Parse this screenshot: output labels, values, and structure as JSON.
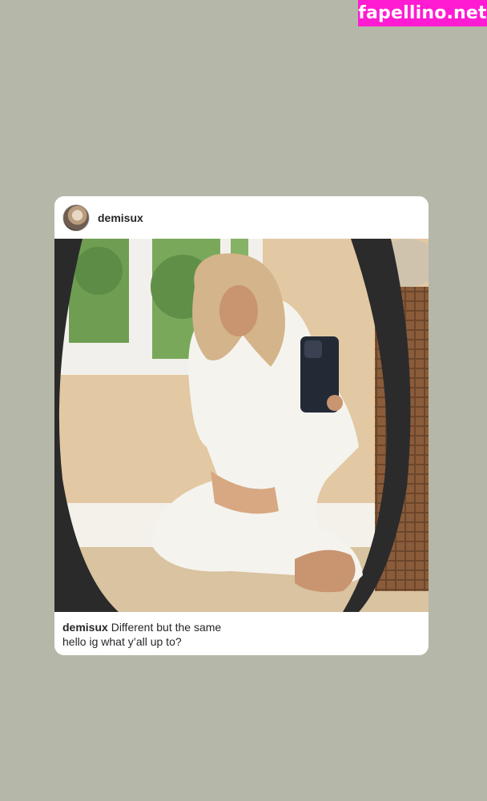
{
  "watermark": {
    "text": "fapellino.net"
  },
  "post": {
    "username": "demisux",
    "caption_user": "demisux",
    "caption_line1": "Different but the same",
    "caption_line2": "hello ig what y’all up to?"
  },
  "colors": {
    "background": "#b5b7a8",
    "watermark_bg": "#ff1bd1",
    "card_bg": "#ffffff",
    "text": "#262626"
  }
}
